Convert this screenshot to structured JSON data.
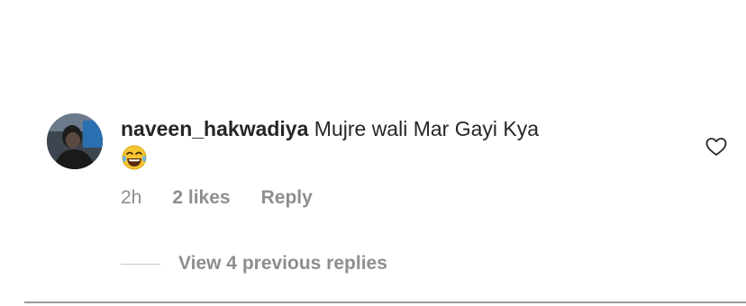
{
  "comment": {
    "username": "naveen_hakwadiya",
    "text": "Mujre wali Mar Gayi Kya",
    "emoji": "😂",
    "time": "2h",
    "likes": "2 likes",
    "reply_label": "Reply",
    "avatar_icon": "user-avatar",
    "like_icon": "heart-outline-icon"
  },
  "replies": {
    "label": "View 4 previous replies"
  }
}
